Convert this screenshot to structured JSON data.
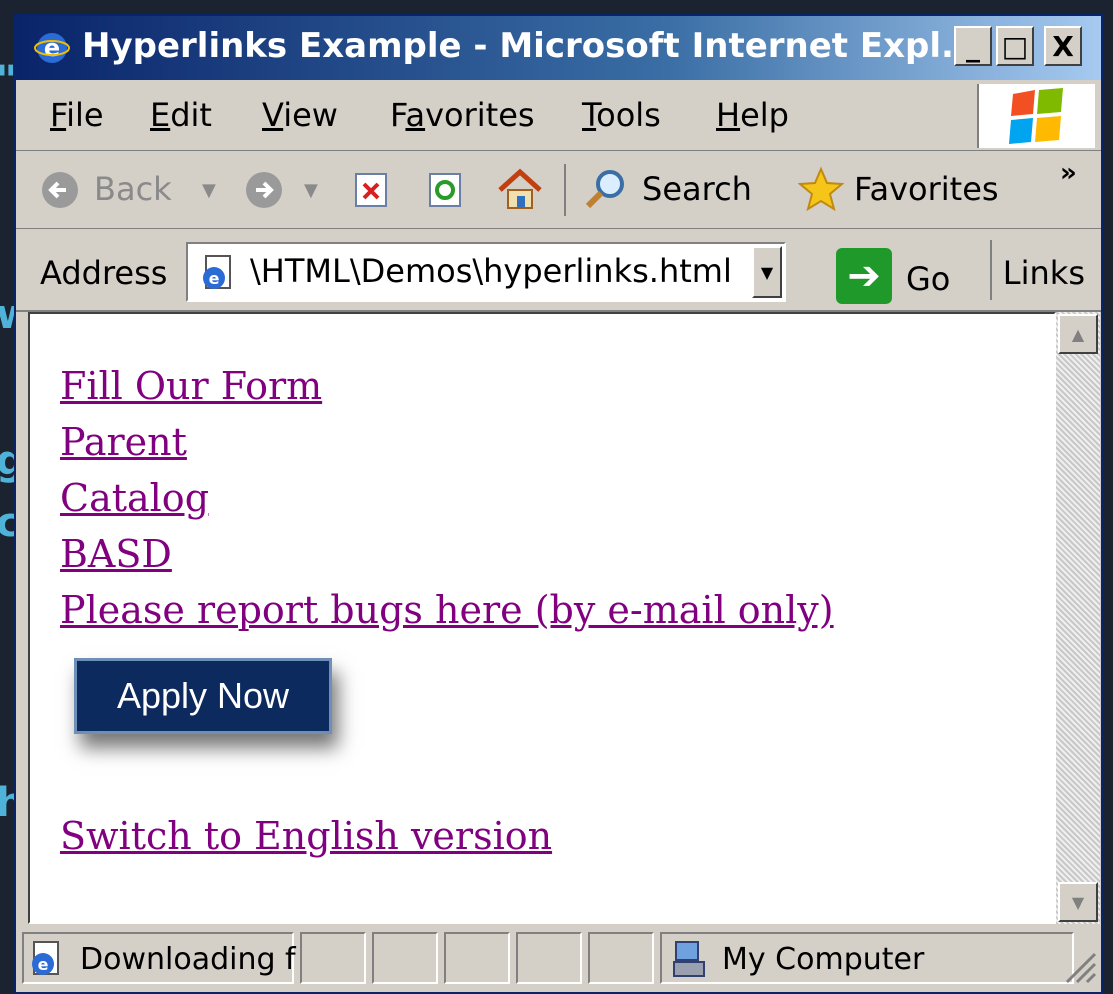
{
  "window": {
    "title": "Hyperlinks Example - Microsoft Internet Expl..."
  },
  "title_buttons": {
    "minimize": "_",
    "maximize": "□",
    "close": "X"
  },
  "menu": [
    "File",
    "Edit",
    "View",
    "Favorites",
    "Tools",
    "Help"
  ],
  "menu_access": [
    "F",
    "E",
    "V",
    "a",
    "T",
    "H"
  ],
  "toolbar": {
    "back": "Back",
    "search": "Search",
    "favorites": "Favorites",
    "more": "»"
  },
  "address": {
    "label": "Address",
    "value": "\\HTML\\Demos\\hyperlinks.html",
    "go": "Go",
    "links": "Links"
  },
  "content": {
    "links": [
      "Fill Our Form",
      "Parent",
      "Catalog",
      "BASD",
      "Please report bugs here (by e-mail only)"
    ],
    "apply_button": "Apply Now",
    "switch_link": "Switch to English version"
  },
  "status": {
    "text": "Downloading f",
    "zone": "My Computer"
  },
  "colors": {
    "visited_link": "#800080",
    "titlebar": "#0a246a",
    "chrome": "#d4d0c8"
  },
  "icons": [
    "ie-icon",
    "windows-logo-icon",
    "back-arrow-icon",
    "forward-arrow-icon",
    "stop-icon",
    "refresh-icon",
    "home-icon",
    "search-icon",
    "favorites-star-icon",
    "page-icon",
    "go-arrow-icon",
    "computer-icon"
  ]
}
